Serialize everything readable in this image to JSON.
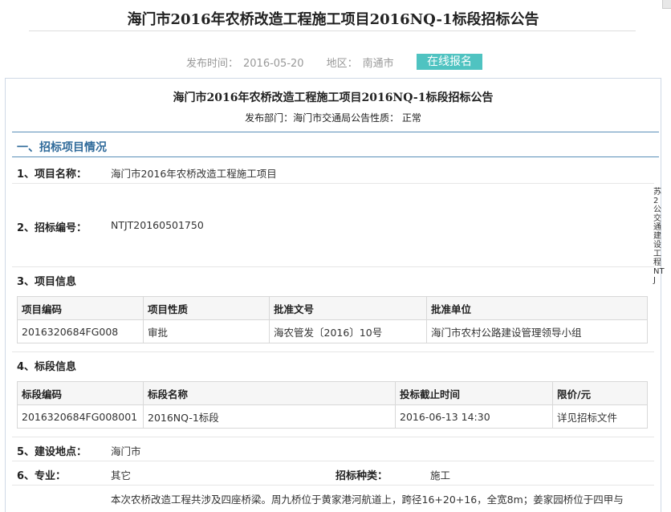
{
  "page": {
    "title": "海门市2016年农桥改造工程施工项目2016NQ-1标段招标公告",
    "publish_label": "发布时间：",
    "publish_date": "2016-05-20",
    "region_label": "地区：",
    "region": "南通市",
    "online_button": "在线报名"
  },
  "panel": {
    "title": "海门市2016年农桥改造工程施工项目2016NQ-1标段招标公告",
    "subtitle": "发布部门：海门市交通局公告性质：  正常",
    "section1": "一、招标项目情况",
    "item1_label": "1、项目名称：",
    "item1_value": "海门市2016年农桥改造工程施工项目",
    "item2_label": "2、招标编号：",
    "item2_value": "NTJT20160501750",
    "item3_label": "3、项目信息",
    "project_table": {
      "headers": [
        "项目编码",
        "项目性质",
        "批准文号",
        "批准单位"
      ],
      "row": [
        "2016320684FG008",
        "审批",
        "海农管发〔2016〕10号",
        "海门市农村公路建设管理领导小组"
      ]
    },
    "item4_label": "4、标段信息",
    "lot_table": {
      "headers": [
        "标段编码",
        "标段名称",
        "投标截止时间",
        "限价/元"
      ],
      "row": [
        "2016320684FG008001",
        "2016NQ-1标段",
        "2016-06-13 14:30",
        "详见招标文件"
      ]
    },
    "item5_label": "5、建设地点：",
    "item5_value": "海门市",
    "item6_label": "6、专业：",
    "item6_value": "其它",
    "type_label": "招标种类：",
    "type_value": "施工",
    "desc": "本次农桥改造工程共涉及四座桥梁。周九桥位于黄家港河航道上，跨径16+20+16，全宽8m；姜家园桥位于四甲与"
  },
  "side_note": "苏2公交通建设工程NTJ"
}
